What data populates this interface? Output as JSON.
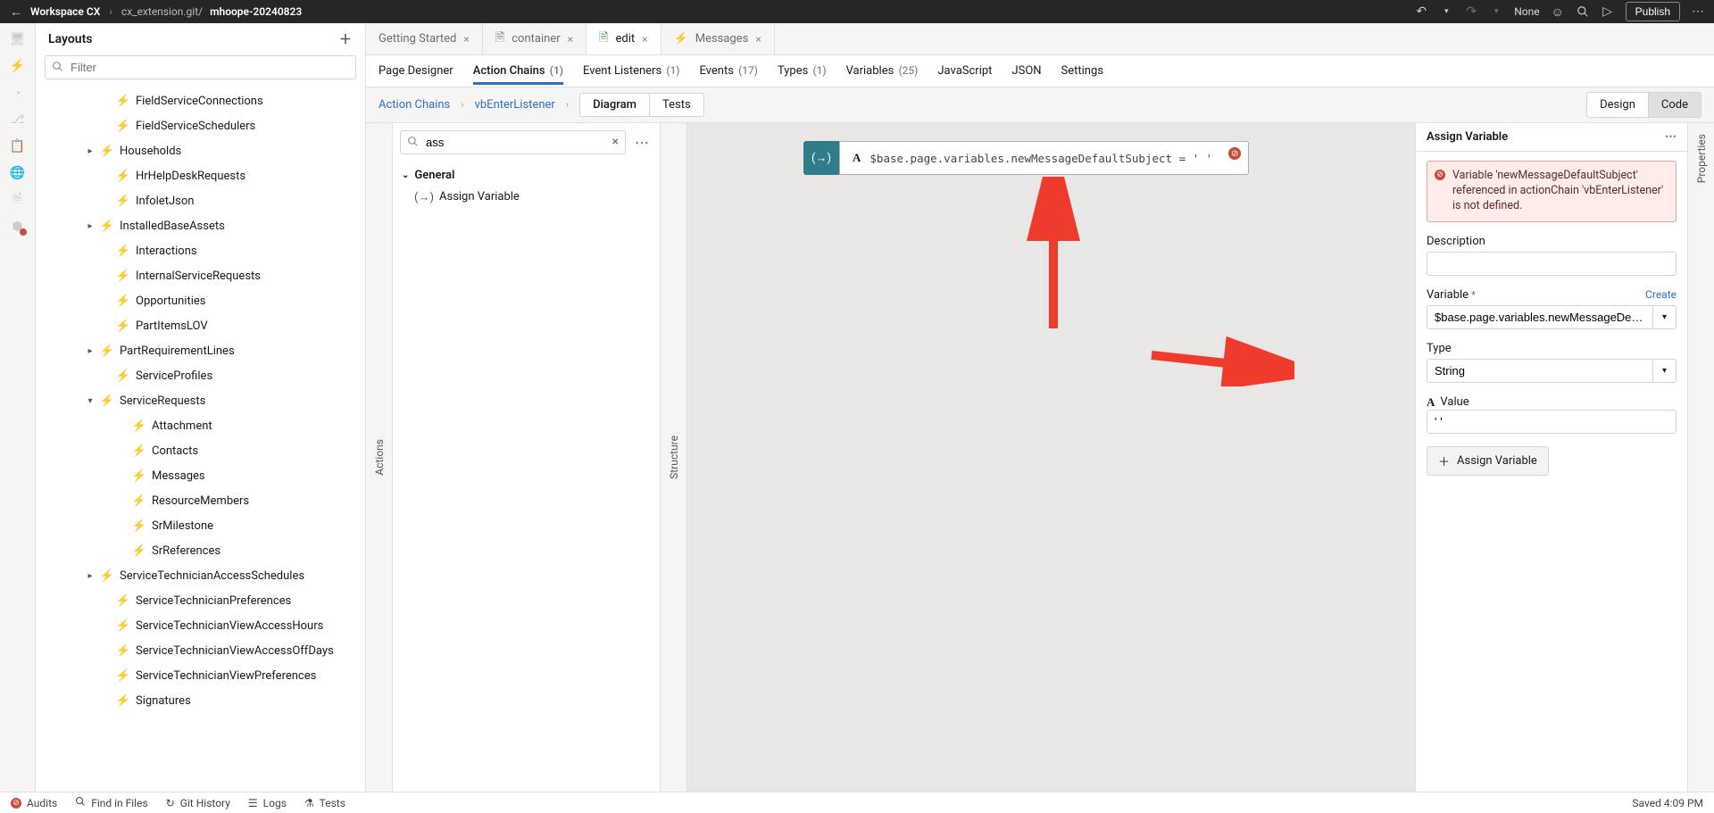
{
  "topbar": {
    "workspace": "Workspace CX",
    "repo": "cx_extension.git/",
    "branch": "mhoope-20240823",
    "none_label": "None",
    "publish_label": "Publish"
  },
  "layouts": {
    "title": "Layouts",
    "filter_placeholder": "Filter",
    "items": [
      {
        "indent": 3,
        "chev": "",
        "icon": "bolt",
        "label": "FieldServiceConnections"
      },
      {
        "indent": 3,
        "chev": "",
        "icon": "bolt",
        "label": "FieldServiceSchedulers"
      },
      {
        "indent": 2,
        "chev": "▸",
        "icon": "bolt",
        "label": "Households"
      },
      {
        "indent": 3,
        "chev": "",
        "icon": "bolt",
        "label": "HrHelpDeskRequests"
      },
      {
        "indent": 3,
        "chev": "",
        "icon": "bolt",
        "label": "InfoletJson"
      },
      {
        "indent": 2,
        "chev": "▸",
        "icon": "bolt",
        "label": "InstalledBaseAssets"
      },
      {
        "indent": 3,
        "chev": "",
        "icon": "bolt",
        "label": "Interactions"
      },
      {
        "indent": 3,
        "chev": "",
        "icon": "bolt",
        "label": "InternalServiceRequests"
      },
      {
        "indent": 3,
        "chev": "",
        "icon": "bolt",
        "label": "Opportunities"
      },
      {
        "indent": 3,
        "chev": "",
        "icon": "bolt",
        "label": "PartItemsLOV"
      },
      {
        "indent": 2,
        "chev": "▸",
        "icon": "bolt",
        "label": "PartRequirementLines"
      },
      {
        "indent": 3,
        "chev": "",
        "icon": "bolt",
        "label": "ServiceProfiles"
      },
      {
        "indent": 2,
        "chev": "▾",
        "icon": "bolt",
        "label": "ServiceRequests"
      },
      {
        "indent": 4,
        "chev": "",
        "icon": "bolt",
        "label": "Attachment"
      },
      {
        "indent": 4,
        "chev": "",
        "icon": "bolt",
        "label": "Contacts"
      },
      {
        "indent": 4,
        "chev": "",
        "icon": "bolt",
        "label": "Messages"
      },
      {
        "indent": 4,
        "chev": "",
        "icon": "bolt",
        "label": "ResourceMembers"
      },
      {
        "indent": 4,
        "chev": "",
        "icon": "bolt",
        "label": "SrMilestone"
      },
      {
        "indent": 4,
        "chev": "",
        "icon": "bolt",
        "label": "SrReferences"
      },
      {
        "indent": 2,
        "chev": "▸",
        "icon": "bolt",
        "label": "ServiceTechnicianAccessSchedules"
      },
      {
        "indent": 3,
        "chev": "",
        "icon": "bolt",
        "label": "ServiceTechnicianPreferences"
      },
      {
        "indent": 3,
        "chev": "",
        "icon": "bolt",
        "label": "ServiceTechnicianViewAccessHours"
      },
      {
        "indent": 3,
        "chev": "",
        "icon": "bolt",
        "label": "ServiceTechnicianViewAccessOffDays"
      },
      {
        "indent": 3,
        "chev": "",
        "icon": "bolt",
        "label": "ServiceTechnicianViewPreferences"
      },
      {
        "indent": 3,
        "chev": "",
        "icon": "bolt",
        "label": "Signatures"
      }
    ]
  },
  "tabs": [
    {
      "icon": "",
      "label": "Getting Started",
      "close": true,
      "active": false
    },
    {
      "icon": "doc",
      "label": "container",
      "close": true,
      "active": false
    },
    {
      "icon": "doc-green",
      "label": "edit",
      "close": true,
      "active": true
    },
    {
      "icon": "bolt",
      "label": "Messages",
      "close": true,
      "active": false
    }
  ],
  "subtabs": [
    {
      "label": "Page Designer",
      "count": "",
      "active": false
    },
    {
      "label": "Action Chains",
      "count": "(1)",
      "active": true
    },
    {
      "label": "Event Listeners",
      "count": "(1)",
      "active": false
    },
    {
      "label": "Events",
      "count": "(17)",
      "active": false
    },
    {
      "label": "Types",
      "count": "(1)",
      "active": false
    },
    {
      "label": "Variables",
      "count": "(25)",
      "active": false
    },
    {
      "label": "JavaScript",
      "count": "",
      "active": false
    },
    {
      "label": "JSON",
      "count": "",
      "active": false
    },
    {
      "label": "Settings",
      "count": "",
      "active": false
    }
  ],
  "chainbar": {
    "root": "Action Chains",
    "chain": "vbEnterListener",
    "diagram": "Diagram",
    "tests": "Tests",
    "design": "Design",
    "code": "Code"
  },
  "actions_rail": "Actions",
  "structure_rail": "Structure",
  "actions_panel": {
    "search_value": "ass",
    "group": "General",
    "item": "Assign Variable"
  },
  "node": {
    "expr": "$base.page.variables.newMessageDefaultSubject = ' '"
  },
  "props": {
    "title": "Assign Variable",
    "rail": "Properties",
    "err": "Variable 'newMessageDefaultSubject' referenced in actionChain 'vbEnterListener' is not defined.",
    "desc_label": "Description",
    "var_label": "Variable",
    "create": "Create",
    "var_value": "$base.page.variables.newMessageDefaultSubject",
    "type_label": "Type",
    "type_value": "String",
    "value_label": "Value",
    "value_value": "' '",
    "add_btn": "Assign Variable"
  },
  "footer": {
    "audits": "Audits",
    "find": "Find in Files",
    "git": "Git History",
    "logs": "Logs",
    "tests": "Tests",
    "saved": "Saved 4:09 PM"
  }
}
